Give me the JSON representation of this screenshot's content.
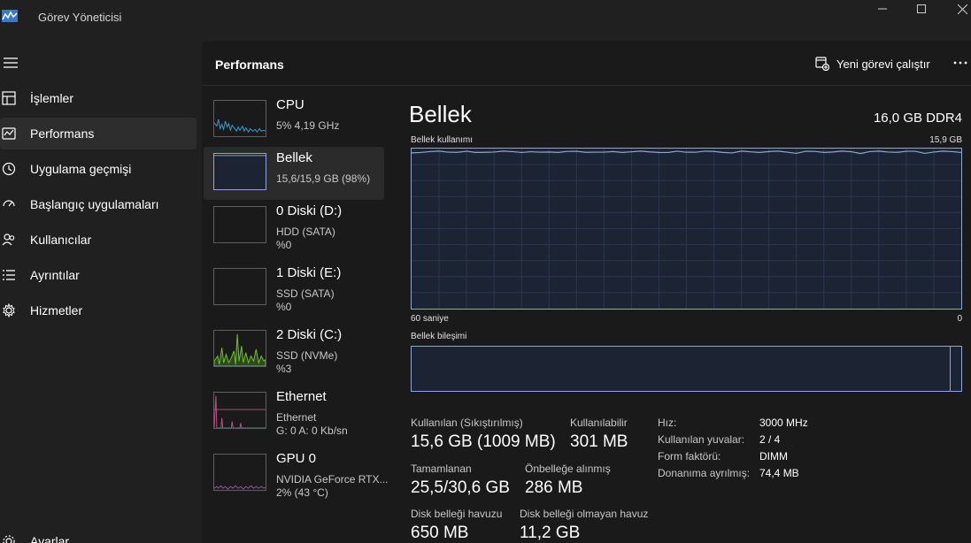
{
  "app": {
    "title": "Görev Yöneticisi"
  },
  "sidebar": {
    "items": [
      {
        "label": "İşlemler",
        "icon": "processes-icon"
      },
      {
        "label": "Performans",
        "icon": "performance-icon",
        "active": true
      },
      {
        "label": "Uygulama geçmişi",
        "icon": "history-icon"
      },
      {
        "label": "Başlangıç uygulamaları",
        "icon": "startup-icon"
      },
      {
        "label": "Kullanıcılar",
        "icon": "users-icon"
      },
      {
        "label": "Ayrıntılar",
        "icon": "details-icon"
      },
      {
        "label": "Hizmetler",
        "icon": "services-icon"
      }
    ],
    "settings_label": "Ayarlar"
  },
  "header": {
    "title": "Performans",
    "run_task_label": "Yeni görevi çalıştır"
  },
  "devices": [
    {
      "name": "CPU",
      "line1": "5% 4,19 GHz",
      "line2": ""
    },
    {
      "name": "Bellek",
      "line1": "15,6/15,9 GB (98%)",
      "line2": ""
    },
    {
      "name": "0 Diski (D:)",
      "line1": "HDD (SATA)",
      "line2": "%0"
    },
    {
      "name": "1 Diski (E:)",
      "line1": "SSD (SATA)",
      "line2": "%0"
    },
    {
      "name": "2 Diski (C:)",
      "line1": "SSD (NVMe)",
      "line2": "%3"
    },
    {
      "name": "Ethernet",
      "line1": "Ethernet",
      "line2": "G: 0 A: 0 Kb/sn"
    },
    {
      "name": "GPU 0",
      "line1": "NVIDIA GeForce RTX...",
      "line2": "2% (43 °C)"
    }
  ],
  "detail": {
    "title": "Bellek",
    "spec": "16,0 GB DDR4",
    "usage_label": "Bellek kullanımı",
    "usage_max": "15,9 GB",
    "time_label": "60 saniye",
    "time_end": "0",
    "composition_label": "Bellek bileşimi",
    "usage_fraction": 0.98,
    "stats": {
      "in_use_label": "Kullanılan (Sıkıştırılmış)",
      "in_use_value": "15,6 GB (1009 MB)",
      "available_label": "Kullanılabilir",
      "available_value": "301 MB",
      "committed_label": "Tamamlanan",
      "committed_value": "25,5/30,6 GB",
      "cached_label": "Önbelleğe alınmış",
      "cached_value": "286 MB",
      "paged_label": "Disk belleği havuzu",
      "paged_value": "650 MB",
      "nonpaged_label": "Disk belleği olmayan havuz",
      "nonpaged_value": "11,2 GB"
    },
    "specs": [
      {
        "label": "Hız:",
        "value": "3000 MHz"
      },
      {
        "label": "Kullanılan yuvalar:",
        "value": "2 / 4"
      },
      {
        "label": "Form faktörü:",
        "value": "DIMM"
      },
      {
        "label": "Donanıma ayrılmış:",
        "value": "74,4 MB"
      }
    ]
  },
  "colors": {
    "memory_line": "#8da6d8",
    "memory_fill": "#1c2434",
    "cpu_line": "#3a9fd0",
    "disk_c_line": "#6fbf3c",
    "ethernet_line": "#c0508a",
    "gpu_line": "#a050b0",
    "accent": "#2d2d2d"
  }
}
